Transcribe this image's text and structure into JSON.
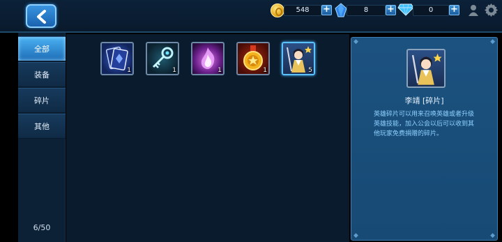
{
  "topbar": {
    "back_icon": "chevron-left-icon",
    "gold_amount": "548",
    "crystal_amount": "8",
    "diamond_amount": "0",
    "icons": [
      "gold-coin-icon",
      "blue-crystal-icon",
      "diamond-icon",
      "person-icon",
      "gear-icon"
    ]
  },
  "nav": {
    "items": [
      {
        "label": "全部",
        "active": true
      },
      {
        "label": "装备",
        "active": false
      },
      {
        "label": "碎片",
        "active": false
      },
      {
        "label": "其他",
        "active": false
      }
    ],
    "count": "6/50"
  },
  "inventory": {
    "items": [
      {
        "icon": "card-icon",
        "qty": "1"
      },
      {
        "icon": "key-icon",
        "qty": "1"
      },
      {
        "icon": "flame-icon",
        "qty": "1"
      },
      {
        "icon": "medal-icon",
        "qty": "1"
      },
      {
        "icon": "hero-fragment-icon",
        "qty": "5"
      }
    ]
  },
  "detail": {
    "name": "李靖 [碎片]",
    "description": "英雄碎片可以用来召唤英雄或者升级英雄技能，加入公会以后可以收到其他玩家免费捐赠的碎片。"
  },
  "colors": {
    "accent": "#3fa9f5",
    "panel": "#1a4e7a",
    "description_text": "#8fd1ff"
  }
}
